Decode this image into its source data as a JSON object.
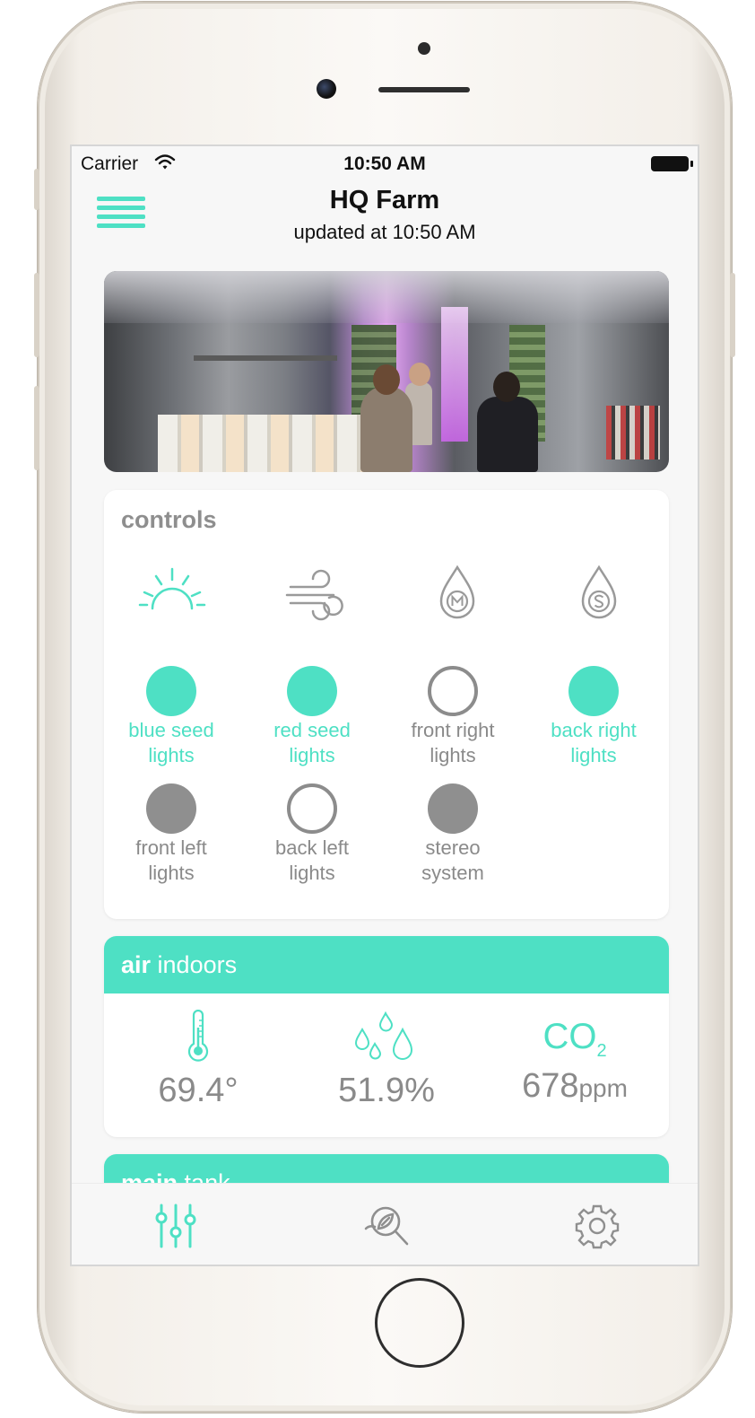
{
  "status_bar": {
    "carrier": "Carrier",
    "time": "10:50 AM"
  },
  "header": {
    "title": "HQ Farm",
    "updated": "updated at 10:50 AM"
  },
  "controls": {
    "title": "controls",
    "mode_icons": [
      {
        "name": "sunrise-icon",
        "active": true
      },
      {
        "name": "wind-icon",
        "active": false
      },
      {
        "name": "drop-m-icon",
        "active": false
      },
      {
        "name": "drop-s-icon",
        "active": false
      }
    ],
    "toggles": [
      {
        "line1": "blue seed",
        "line2": "lights",
        "state": "on"
      },
      {
        "line1": "red seed",
        "line2": "lights",
        "state": "on"
      },
      {
        "line1": "front right",
        "line2": "lights",
        "state": "off"
      },
      {
        "line1": "back right",
        "line2": "lights",
        "state": "on"
      },
      {
        "line1": "front left",
        "line2": "lights",
        "state": "unavailable"
      },
      {
        "line1": "back left",
        "line2": "lights",
        "state": "off"
      },
      {
        "line1": "stereo",
        "line2": "system",
        "state": "unavailable"
      }
    ]
  },
  "air": {
    "title_bold": "air",
    "title_rest": "indoors",
    "temperature": "69.4°",
    "humidity": "51.9%",
    "co2_label": "CO",
    "co2_sub": "2",
    "co2_value": "678",
    "co2_unit": "ppm"
  },
  "tank": {
    "title_bold": "main",
    "title_rest": "tank"
  },
  "tabs": [
    {
      "name": "controls-tab",
      "icon": "sliders-icon",
      "active": true
    },
    {
      "name": "explore-tab",
      "icon": "leaf-search-icon",
      "active": false
    },
    {
      "name": "settings-tab",
      "icon": "gear-icon",
      "active": false
    }
  ],
  "colors": {
    "accent": "#4ee0c4",
    "muted": "#8a8a8a",
    "background": "#f7f7f7"
  }
}
